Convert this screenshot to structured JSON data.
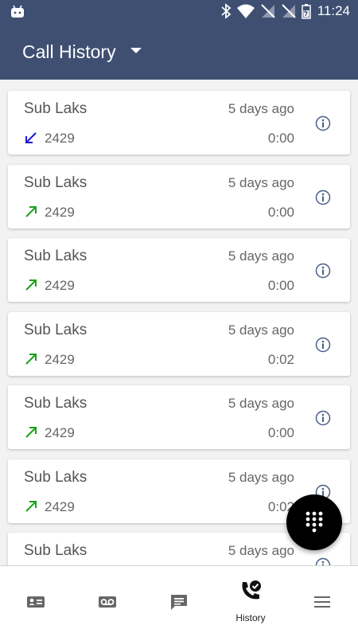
{
  "status_bar": {
    "time": "11:24"
  },
  "app_bar": {
    "title": "Call History"
  },
  "calls": [
    {
      "name": "Sub Laks",
      "when": "5 days ago",
      "extension": "2429",
      "duration": "0:00",
      "direction": "incoming"
    },
    {
      "name": "Sub Laks",
      "when": "5 days ago",
      "extension": "2429",
      "duration": "0:00",
      "direction": "outgoing"
    },
    {
      "name": "Sub Laks",
      "when": "5 days ago",
      "extension": "2429",
      "duration": "0:00",
      "direction": "outgoing"
    },
    {
      "name": "Sub Laks",
      "when": "5 days ago",
      "extension": "2429",
      "duration": "0:02",
      "direction": "outgoing"
    },
    {
      "name": "Sub Laks",
      "when": "5 days ago",
      "extension": "2429",
      "duration": "0:00",
      "direction": "outgoing"
    },
    {
      "name": "Sub Laks",
      "when": "5 days ago",
      "extension": "2429",
      "duration": "0:02",
      "direction": "outgoing"
    },
    {
      "name": "Sub Laks",
      "when": "5 days ago",
      "extension": "",
      "duration": "",
      "direction": ""
    }
  ],
  "colors": {
    "app_bar": "#3e4f72",
    "incoming_arrow": "#1a1adb",
    "outgoing_arrow": "#1aa31a",
    "info_icon": "#4a5e88"
  },
  "bottom_nav": {
    "items": [
      {
        "icon": "contacts-card-icon",
        "label": ""
      },
      {
        "icon": "voicemail-icon",
        "label": ""
      },
      {
        "icon": "chat-icon",
        "label": ""
      },
      {
        "icon": "call-history-icon",
        "label": "History"
      },
      {
        "icon": "menu-icon",
        "label": ""
      }
    ]
  },
  "fab": {
    "icon": "dialpad-icon"
  }
}
